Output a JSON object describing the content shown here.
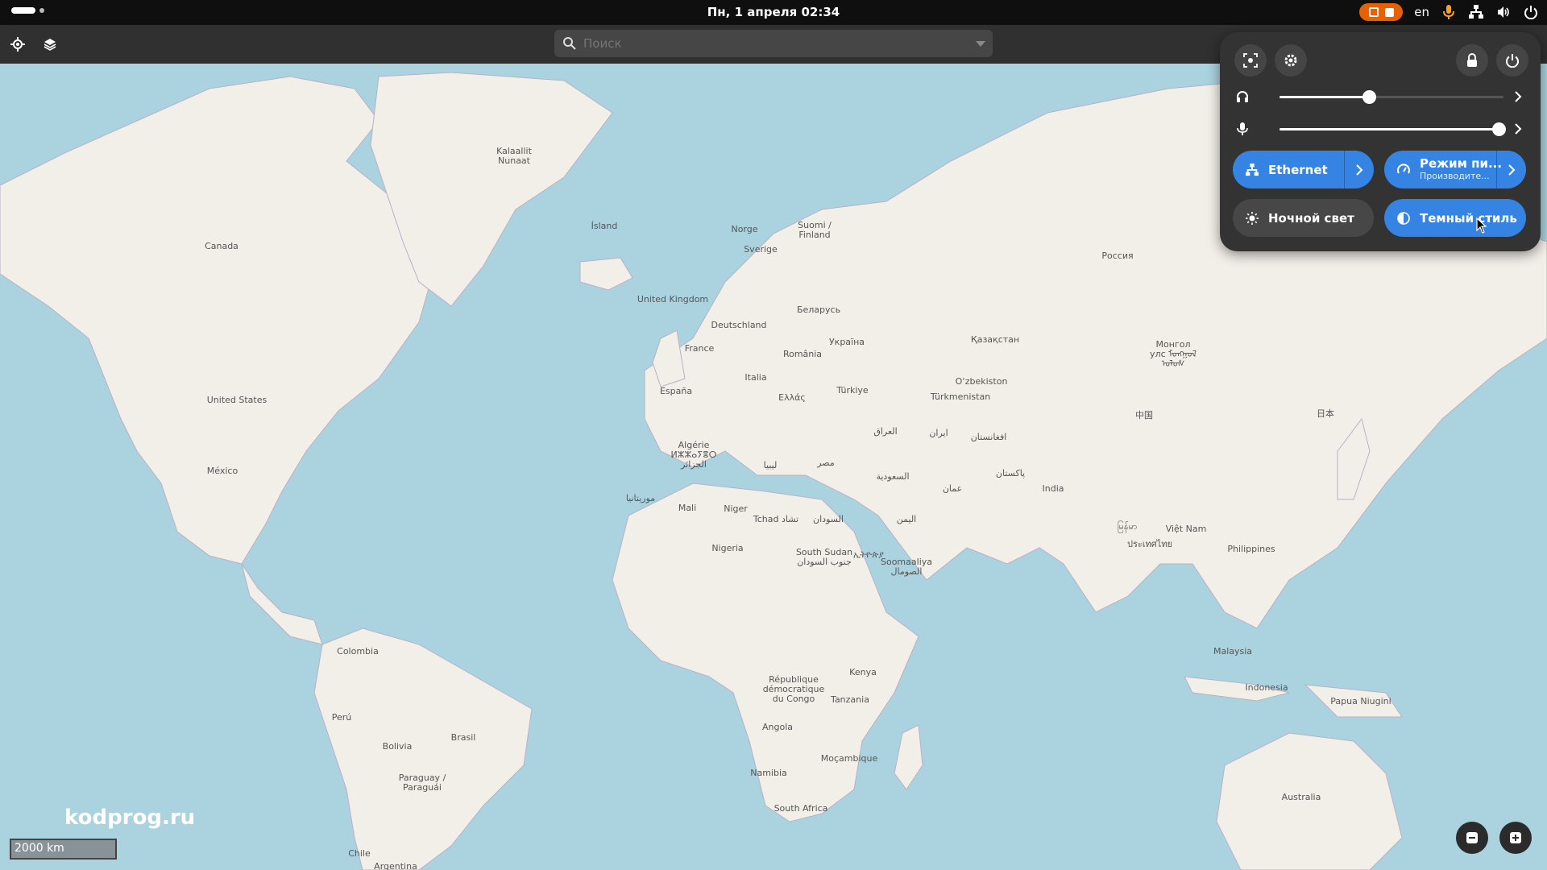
{
  "topbar": {
    "clock": "Пн, 1 апреля  02:34",
    "language": "en",
    "icons": [
      "screen-recording-icon",
      "microphone-icon",
      "network-icon",
      "volume-icon",
      "power-icon"
    ]
  },
  "header": {
    "search_placeholder": "Поиск"
  },
  "map": {
    "labels": [
      {
        "text": "Kalaallit\nNunaat"
      },
      {
        "text": "Ísland"
      },
      {
        "text": "Canada"
      },
      {
        "text": "Norge"
      },
      {
        "text": "Suomi /\nFinland"
      },
      {
        "text": "Sverige"
      },
      {
        "text": "Россия"
      },
      {
        "text": "United Kingdom"
      },
      {
        "text": "Беларусь"
      },
      {
        "text": "Deutschland"
      },
      {
        "text": "Україна"
      },
      {
        "text": "France"
      },
      {
        "text": "România"
      },
      {
        "text": "Қазақстан"
      },
      {
        "text": "Монгол\nулс ᠮᠣᠩᠭᠣᠯ\nᠤᠯᠤᠰ"
      },
      {
        "text": "Italia"
      },
      {
        "text": "O‘zbekiston"
      },
      {
        "text": "España"
      },
      {
        "text": "Ελλάς"
      },
      {
        "text": "Türkiye"
      },
      {
        "text": "Türkmenistan"
      },
      {
        "text": "United States"
      },
      {
        "text": "中国"
      },
      {
        "text": "日本"
      },
      {
        "text": "العراق"
      },
      {
        "text": "ایران"
      },
      {
        "text": "افغانستان"
      },
      {
        "text": "Algérie\nⵍⵣⵣⴰⵢⴻⵔ\nالجزائر"
      },
      {
        "text": "ليبيا"
      },
      {
        "text": "مصر"
      },
      {
        "text": "پاکستان"
      },
      {
        "text": "México"
      },
      {
        "text": "السعودية"
      },
      {
        "text": "عمان"
      },
      {
        "text": "India"
      },
      {
        "text": "موريتانيا"
      },
      {
        "text": "Mali"
      },
      {
        "text": "Niger"
      },
      {
        "text": "Tchad تشاد"
      },
      {
        "text": "السودان"
      },
      {
        "text": "اليمن"
      },
      {
        "text": "မြန်မာ"
      },
      {
        "text": "Việt Nam"
      },
      {
        "text": "ประเทศไทย"
      },
      {
        "text": "Philippines"
      },
      {
        "text": "Nigeria"
      },
      {
        "text": "South Sudan\nجنوب السودان"
      },
      {
        "text": "ኢትዮጵያ"
      },
      {
        "text": "Soomaaliya\nالصومال"
      },
      {
        "text": "Colombia"
      },
      {
        "text": "Malaysia"
      },
      {
        "text": "Kenya"
      },
      {
        "text": "République\ndémocratique\ndu Congo"
      },
      {
        "text": "Indonesia"
      },
      {
        "text": "Tanzania"
      },
      {
        "text": "Papua Niugini"
      },
      {
        "text": "Perú"
      },
      {
        "text": "Brasil"
      },
      {
        "text": "Angola"
      },
      {
        "text": "Bolivia"
      },
      {
        "text": "Moçambique"
      },
      {
        "text": "Namibia"
      },
      {
        "text": "Paraguay /\nParaguái"
      },
      {
        "text": "Australia"
      },
      {
        "text": "South Africa"
      },
      {
        "text": "Chile"
      },
      {
        "text": "Argentina"
      }
    ],
    "watermark": "kodprog.ru",
    "scale": "2000 km"
  },
  "quick_settings": {
    "output_volume": 0.4,
    "input_volume": 0.98,
    "ethernet_label": "Ethernet",
    "power_mode_label": "Режим пи...",
    "power_mode_sub": "Производите...",
    "night_light_label": "Ночной свет",
    "dark_style_label": "Темный стиль"
  },
  "colors": {
    "accent": "#3584e4",
    "water": "#aad3df",
    "land": "#f2efe9",
    "panel": "#333333"
  }
}
